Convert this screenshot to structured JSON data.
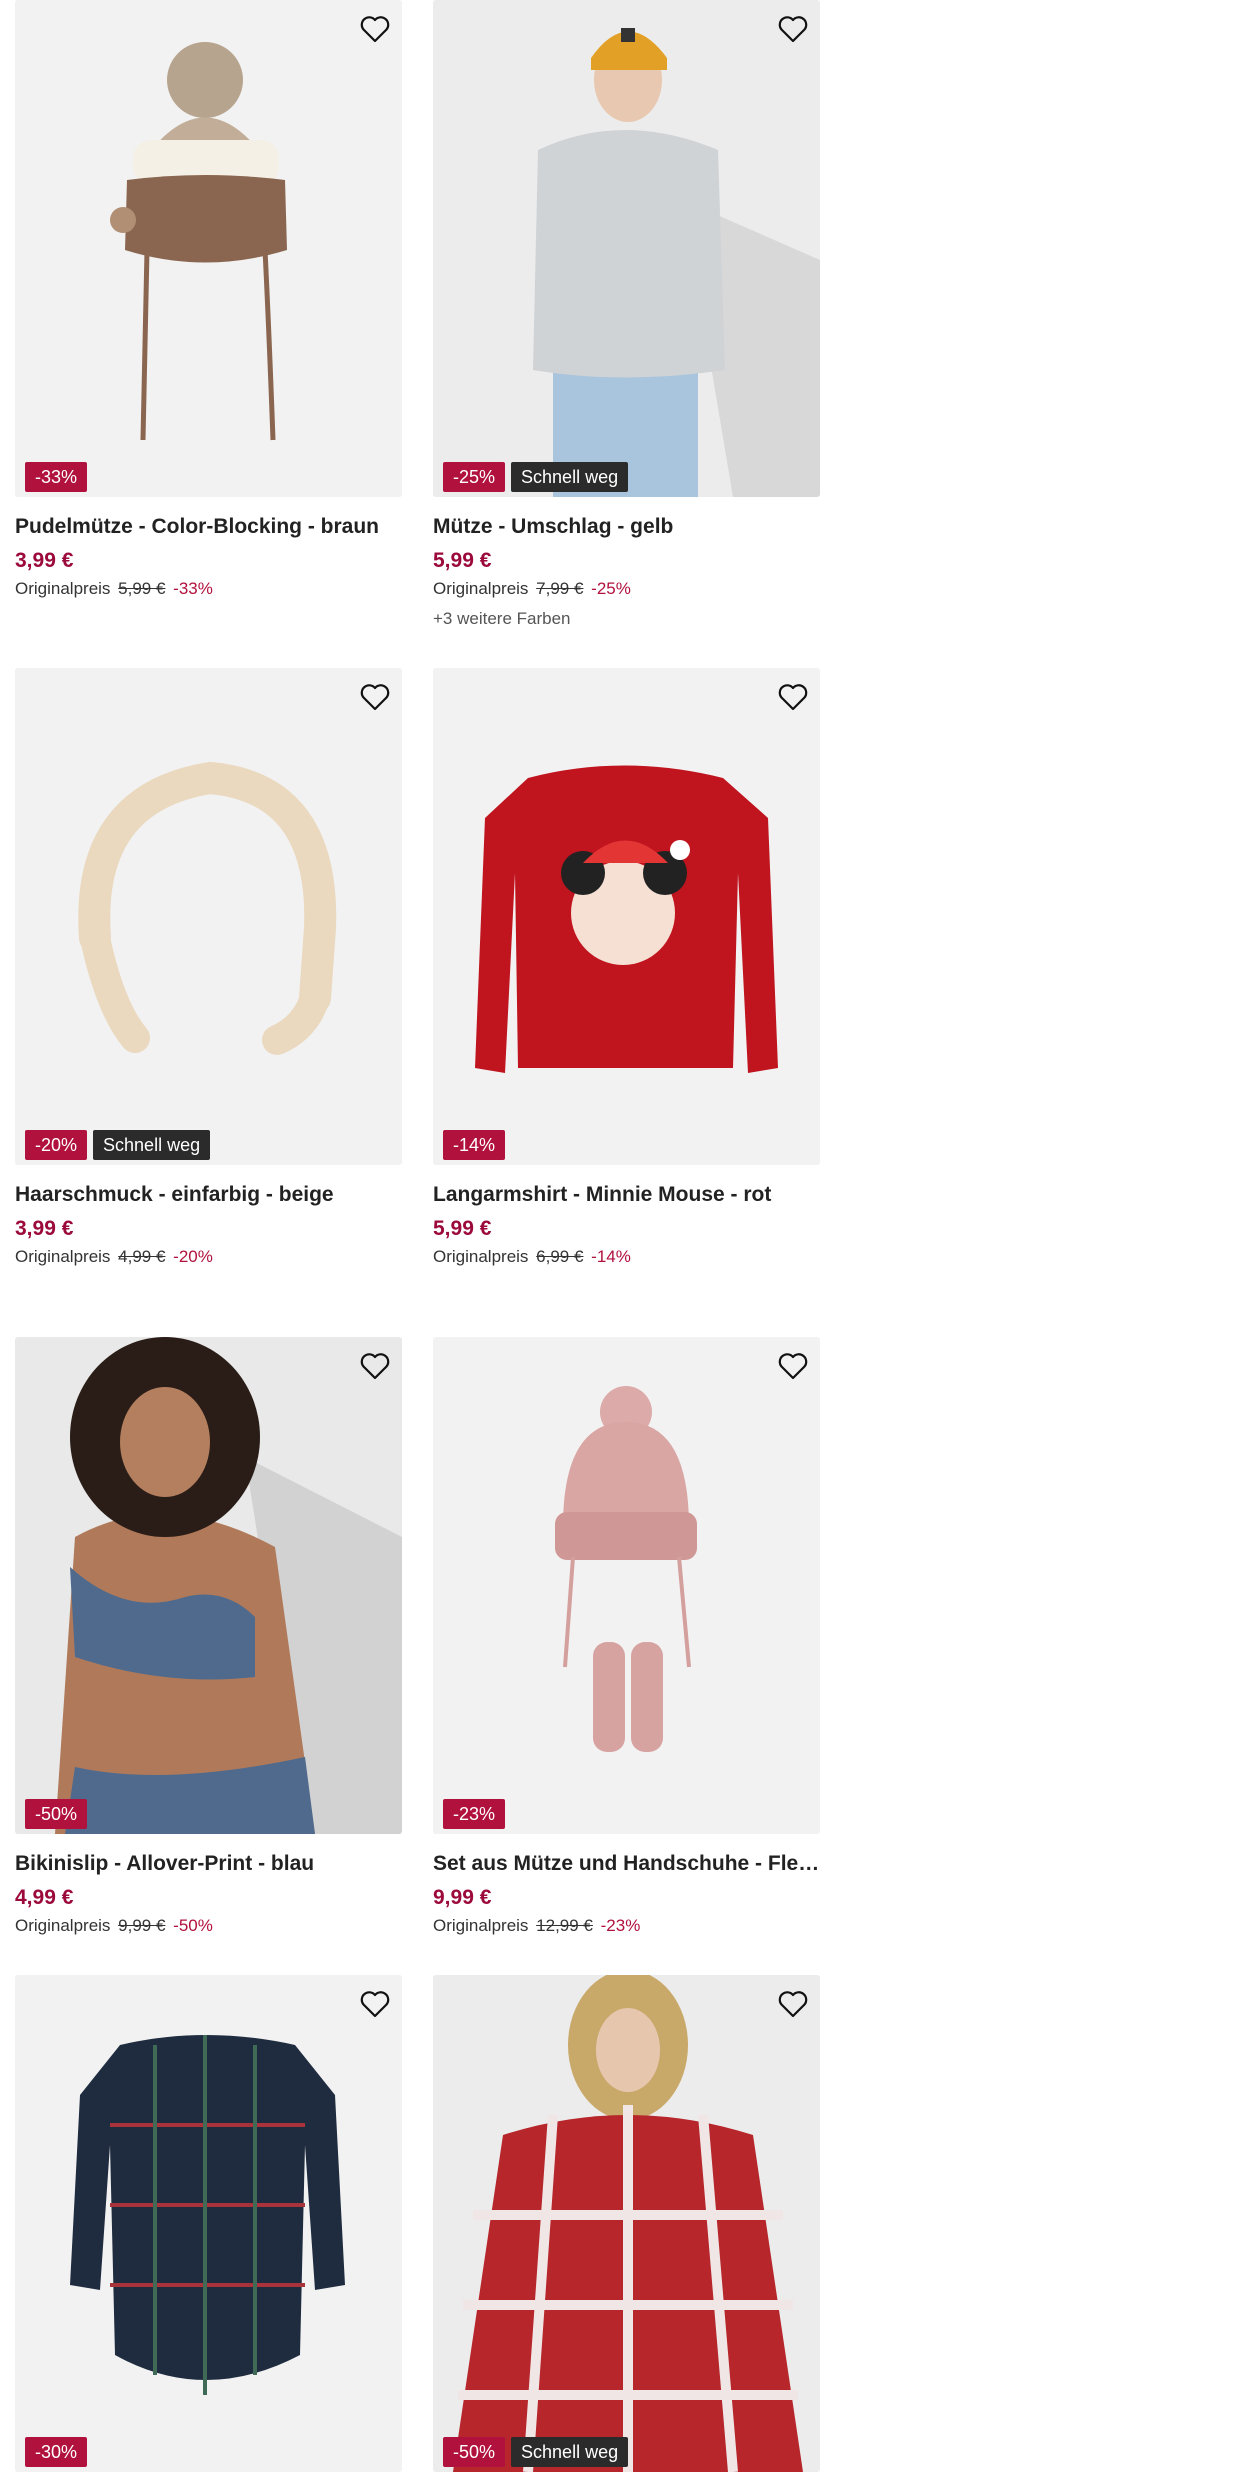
{
  "products": [
    {
      "title": "Pudelmütze - Color-Blocking - braun",
      "price": "3,99 €",
      "orig_label": "Originalpreis",
      "orig_price": "5,99 €",
      "discount": "-33%",
      "badge_sale": "-33%",
      "badge_fast": "",
      "more_colors": ""
    },
    {
      "title": "Mütze - Umschlag - gelb",
      "price": "5,99 €",
      "orig_label": "Originalpreis",
      "orig_price": "7,99 €",
      "discount": "-25%",
      "badge_sale": "-25%",
      "badge_fast": "Schnell weg",
      "more_colors": "+3 weitere Farben"
    },
    {
      "title": "Haarschmuck - einfarbig - beige",
      "price": "3,99 €",
      "orig_label": "Originalpreis",
      "orig_price": "4,99 €",
      "discount": "-20%",
      "badge_sale": "-20%",
      "badge_fast": "Schnell weg",
      "more_colors": ""
    },
    {
      "title": "Langarmshirt - Minnie Mouse - rot",
      "price": "5,99 €",
      "orig_label": "Originalpreis",
      "orig_price": "6,99 €",
      "discount": "-14%",
      "badge_sale": "-14%",
      "badge_fast": "",
      "more_colors": ""
    },
    {
      "title": "Bikinislip - Allover-Print - blau",
      "price": "4,99 €",
      "orig_label": "Originalpreis",
      "orig_price": "9,99 €",
      "discount": "-50%",
      "badge_sale": "-50%",
      "badge_fast": "",
      "more_colors": ""
    },
    {
      "title": "Set aus Mütze und Handschuhe - Fleecef...",
      "price": "9,99 €",
      "orig_label": "Originalpreis",
      "orig_price": "12,99 €",
      "discount": "-23%",
      "badge_sale": "-23%",
      "badge_fast": "",
      "more_colors": ""
    },
    {
      "title": "",
      "price": "",
      "orig_label": "",
      "orig_price": "",
      "discount": "",
      "badge_sale": "-30%",
      "badge_fast": "",
      "more_colors": ""
    },
    {
      "title": "",
      "price": "",
      "orig_label": "",
      "orig_price": "",
      "discount": "",
      "badge_sale": "-50%",
      "badge_fast": "Schnell weg",
      "more_colors": ""
    }
  ],
  "icons": {
    "favorite": "heart-outline-icon"
  },
  "colors": {
    "sale_red": "#b1113d",
    "price_red": "#9b0a3a",
    "badge_dark": "#2b2b2b"
  }
}
